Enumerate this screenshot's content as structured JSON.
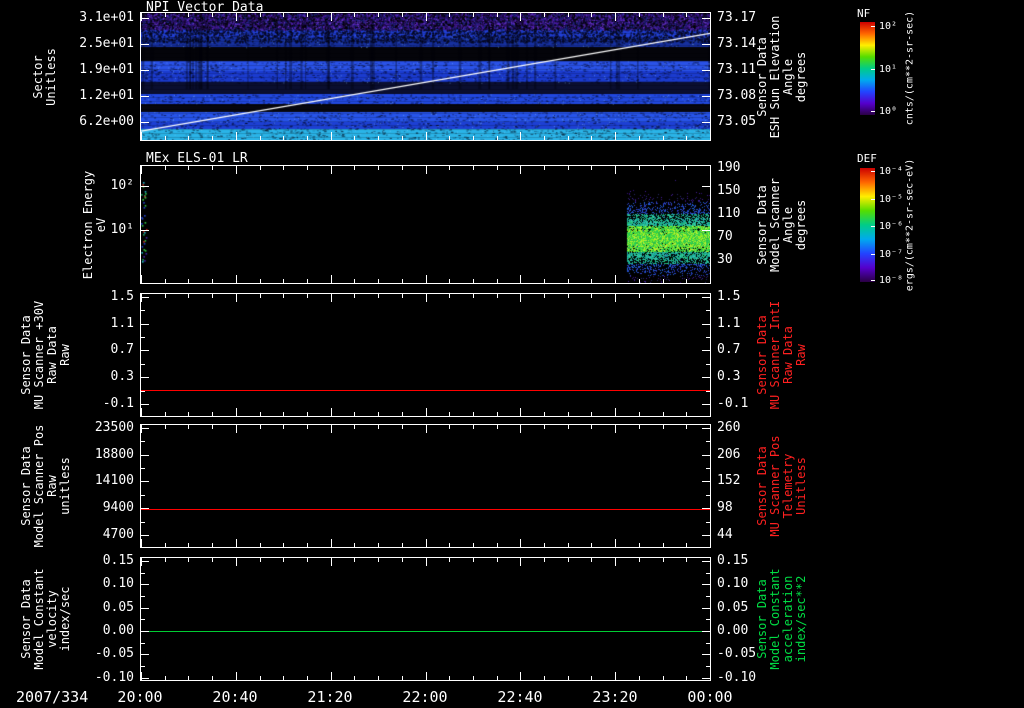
{
  "x_axis": {
    "date_label": "2007/334",
    "tick_labels": [
      "20:00",
      "20:40",
      "21:20",
      "22:00",
      "22:40",
      "23:20",
      "00:00"
    ]
  },
  "colorbars": [
    {
      "title": "NF",
      "unit": "cnts/(cm**2-sr-sec)",
      "tick_labels": [
        "10²",
        "10¹",
        "10⁰"
      ],
      "tick_fracs": [
        0.04,
        0.5,
        0.96
      ],
      "gradient": [
        "#cc0000",
        "#ff6600",
        "#ffee00",
        "#55dd00",
        "#00cc88",
        "#00aaee",
        "#2244ff",
        "#5500cc",
        "#2a0044"
      ]
    },
    {
      "title": "DEF",
      "unit": "ergs/(cm**2-sr-sec-eV)",
      "tick_labels": [
        "10⁻⁴",
        "10⁻⁵",
        "10⁻⁶",
        "10⁻⁷",
        "10⁻⁸"
      ],
      "tick_fracs": [
        0.03,
        0.27,
        0.51,
        0.75,
        0.98
      ],
      "gradient": [
        "#cc0000",
        "#ff6600",
        "#ffee00",
        "#55dd00",
        "#00cc88",
        "#00aaee",
        "#2244ff",
        "#5500cc",
        "#2a0044"
      ]
    }
  ],
  "chart_data": [
    {
      "id": "panel-1",
      "type": "heatmap",
      "title": "NPI Vector Data",
      "left_axis": {
        "label": "Sector\nUnitless",
        "tick_labels": [
          "3.1e+01",
          "2.5e+01",
          "1.9e+01",
          "1.2e+01",
          "6.2e+00"
        ],
        "tick_fracs": [
          0.04,
          0.244,
          0.447,
          0.651,
          0.855
        ],
        "color": "#ffffff"
      },
      "right_axis": {
        "label": "Sensor Data\nESH Sun Elevation\nAngle\ndegrees",
        "tick_labels": [
          "73.17",
          "73.14",
          "73.11",
          "73.08",
          "73.05"
        ],
        "tick_fracs": [
          0.04,
          0.244,
          0.447,
          0.651,
          0.855
        ],
        "color": "#ffffff"
      },
      "heatmap": {
        "bands": [
          [
            0.0,
            0.13,
            "#0c0620",
            "speckle"
          ],
          [
            0.13,
            0.2,
            "#2140d8",
            "noisy"
          ],
          [
            0.2,
            0.27,
            "#16309f",
            "noisy"
          ],
          [
            0.27,
            0.38,
            "#04040a",
            "flat"
          ],
          [
            0.38,
            0.46,
            "#2a52e8",
            "noisy"
          ],
          [
            0.46,
            0.55,
            "#1b3bcf",
            "noisy"
          ],
          [
            0.55,
            0.64,
            "#0a0e30",
            "flat"
          ],
          [
            0.64,
            0.72,
            "#2148e0",
            "noisy"
          ],
          [
            0.72,
            0.78,
            "#06060e",
            "flat"
          ],
          [
            0.78,
            0.86,
            "#2754ea",
            "noisy"
          ],
          [
            0.86,
            0.92,
            "#1d40d4",
            "noisy"
          ],
          [
            0.92,
            1.0,
            "#2ab4e8",
            "noisy"
          ]
        ]
      },
      "overlay_line": {
        "color": "#ffffff",
        "value_start": 73.04,
        "value_end": 73.15,
        "y_start_frac": 0.93,
        "y_end_frac": 0.16
      }
    },
    {
      "id": "panel-2",
      "type": "heatmap",
      "title": "MEx ELS-01 LR",
      "left_axis": {
        "label": "Electron Energy\neV",
        "tick_labels": [
          "10²",
          "10¹"
        ],
        "tick_fracs": [
          0.17,
          0.55
        ],
        "color": "#ffffff"
      },
      "right_axis": {
        "label": "Sensor Data\nModel Scanner\nAngle\ndegrees",
        "tick_labels": [
          "190",
          "150",
          "110",
          "70",
          "30"
        ],
        "tick_fracs": [
          0.02,
          0.215,
          0.41,
          0.605,
          0.8
        ],
        "color": "#ffffff"
      },
      "heatmap": {
        "background": "#000000",
        "left_strip": {
          "x_frac": [
            0,
            0.01
          ],
          "y_frac": [
            0.12,
            0.82
          ]
        },
        "blob": {
          "x_frac": [
            0.855,
            1.0
          ],
          "y_center_frac": 0.62,
          "y_sigma_frac": 0.17
        }
      }
    },
    {
      "id": "panel-3",
      "type": "line",
      "left_axis": {
        "label": "Sensor Data\nMU Scanner +30V\nRaw Data\nRaw",
        "tick_labels": [
          "1.5",
          "1.1",
          "0.7",
          "0.3",
          "-0.1"
        ],
        "tick_fracs": [
          0.025,
          0.244,
          0.463,
          0.682,
          0.9
        ],
        "color": "#ffffff"
      },
      "right_axis": {
        "label": "Sensor Data\nMU Scanner IntI\nRaw Data\nRaw",
        "tick_labels": [
          "1.5",
          "1.1",
          "0.7",
          "0.3",
          "-0.1"
        ],
        "tick_fracs": [
          0.025,
          0.244,
          0.463,
          0.682,
          0.9
        ],
        "color": "#ff2020"
      },
      "series": [
        {
          "name": "mu-scanner-raw",
          "color": "#ff0000",
          "constant_value": 0.1,
          "y_frac": 0.79
        }
      ]
    },
    {
      "id": "panel-4",
      "type": "line",
      "left_axis": {
        "label": "Sensor Data\nModel Scanner Pos\nRaw\nunitless",
        "tick_labels": [
          "23500",
          "18800",
          "14100",
          "9400",
          "4700"
        ],
        "tick_fracs": [
          0.025,
          0.244,
          0.463,
          0.682,
          0.9
        ],
        "color": "#ffffff"
      },
      "right_axis": {
        "label": "Sensor Data\nMU Scanner Pos\nTelemetry\nUnitless",
        "tick_labels": [
          "260",
          "206",
          "152",
          "98",
          "44"
        ],
        "tick_fracs": [
          0.025,
          0.244,
          0.463,
          0.682,
          0.9
        ],
        "color": "#ff2020"
      },
      "series": [
        {
          "name": "model-scanner-pos",
          "color": "#ff0000",
          "constant_value": 9200,
          "y_frac": 0.692
        }
      ]
    },
    {
      "id": "panel-5",
      "type": "line",
      "left_axis": {
        "label": "Sensor Data\nModel Constant\nvelocity\nindex/sec",
        "tick_labels": [
          "0.15",
          "0.10",
          "0.05",
          "0.00",
          "-0.05",
          "-0.10"
        ],
        "tick_fracs": [
          0.024,
          0.215,
          0.406,
          0.598,
          0.789,
          0.98
        ],
        "color": "#ffffff"
      },
      "right_axis": {
        "label": "Sensor Data\nModel Constant\nacceleration\nindex/sec**2",
        "tick_labels": [
          "0.15",
          "0.10",
          "0.05",
          "0.00",
          "-0.05",
          "-0.10"
        ],
        "tick_fracs": [
          0.024,
          0.215,
          0.406,
          0.598,
          0.789,
          0.98
        ],
        "color": "#00dd44"
      },
      "series": [
        {
          "name": "model-constant-velocity",
          "color": "#00cc33",
          "constant_value": 0.0,
          "y_frac": 0.598
        }
      ]
    }
  ]
}
